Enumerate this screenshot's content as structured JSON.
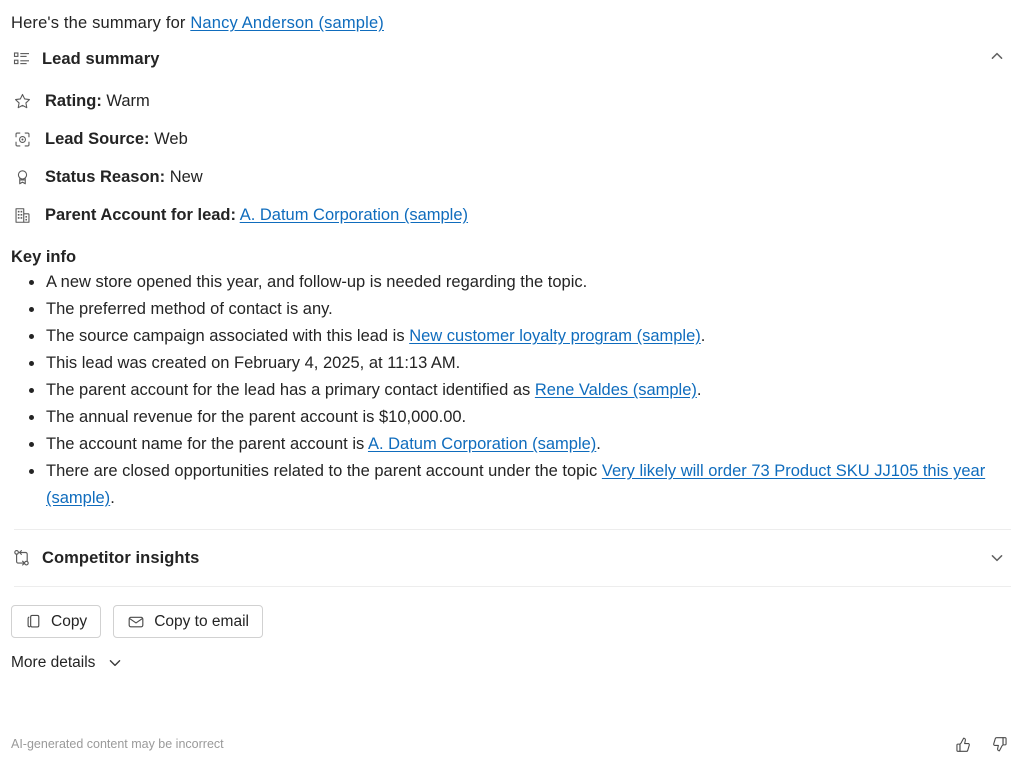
{
  "intro": {
    "prefix": "Here's the summary for ",
    "link_text": "Nancy Anderson (sample)"
  },
  "lead_summary": {
    "title": "Lead summary",
    "icon": "summary-list-icon",
    "expanded": true,
    "chevron": "chevron-up-icon",
    "attributes": [
      {
        "icon": "star-icon",
        "label": "Rating:",
        "value": "Warm",
        "is_link": false
      },
      {
        "icon": "target-scan-icon",
        "label": "Lead Source:",
        "value": "Web",
        "is_link": false
      },
      {
        "icon": "ribbon-badge-icon",
        "label": "Status Reason:",
        "value": "New",
        "is_link": false
      },
      {
        "icon": "building-icon",
        "label": "Parent Account for lead:",
        "value": "A. Datum Corporation (sample)",
        "is_link": true
      }
    ]
  },
  "key_info": {
    "title": "Key info",
    "bullets": [
      {
        "parts": [
          {
            "t": "A new store opened this year, and follow-up is needed regarding the topic.",
            "link": false
          }
        ]
      },
      {
        "parts": [
          {
            "t": "The preferred method of contact is any.",
            "link": false
          }
        ]
      },
      {
        "parts": [
          {
            "t": "The source campaign associated with this lead is ",
            "link": false
          },
          {
            "t": "New customer loyalty program (sample)",
            "link": true
          },
          {
            "t": ".",
            "link": false
          }
        ]
      },
      {
        "parts": [
          {
            "t": "This lead was created on February 4, 2025, at 11:13 AM.",
            "link": false
          }
        ]
      },
      {
        "parts": [
          {
            "t": "The parent account for the lead has a primary contact identified as ",
            "link": false
          },
          {
            "t": "Rene Valdes (sample)",
            "link": true
          },
          {
            "t": ".",
            "link": false
          }
        ]
      },
      {
        "parts": [
          {
            "t": "The annual revenue for the parent account is $10,000.00.",
            "link": false
          }
        ]
      },
      {
        "parts": [
          {
            "t": "The account name for the parent account is ",
            "link": false
          },
          {
            "t": "A. Datum Corporation (sample)",
            "link": true
          },
          {
            "t": ".",
            "link": false
          }
        ]
      },
      {
        "parts": [
          {
            "t": "There are closed opportunities related to the parent account under the topic ",
            "link": false
          },
          {
            "t": "Very likely will order 73 Product SKU JJ105 this year (sample)",
            "link": true
          },
          {
            "t": ".",
            "link": false
          }
        ]
      }
    ]
  },
  "competitor_insights": {
    "title": "Competitor insights",
    "icon": "branch-swap-icon",
    "expanded": false,
    "chevron": "chevron-down-icon"
  },
  "actions": {
    "copy": {
      "label": "Copy",
      "icon": "copy-icon"
    },
    "copy_to_email": {
      "label": "Copy to email",
      "icon": "envelope-icon"
    }
  },
  "more_details": {
    "label": "More details",
    "icon": "chevron-down-icon"
  },
  "footer": {
    "disclaimer": "AI-generated content may be incorrect",
    "thumbs_up_icon": "thumbs-up-icon",
    "thumbs_down_icon": "thumbs-down-icon"
  },
  "colors": {
    "link": "#0f6cbd",
    "text": "#242424",
    "muted": "#9a9a9a",
    "divider": "#ededed",
    "icon_stroke": "#5a5a5a"
  }
}
